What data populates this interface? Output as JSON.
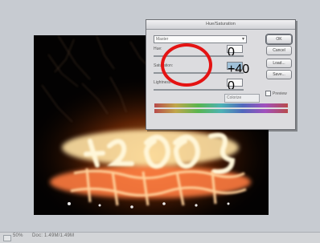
{
  "dialog": {
    "title": "Hue/Saturation",
    "edit_value": "Master",
    "rows": [
      {
        "label": "Hue:",
        "value": "0",
        "highlight": false
      },
      {
        "label": "Saturation:",
        "value": "+40",
        "highlight": true
      },
      {
        "label": "Lightness:",
        "value": "0",
        "highlight": false
      }
    ],
    "buttons": [
      "OK",
      "Cancel",
      "Load...",
      "Save..."
    ],
    "colorize_label": "Colorize",
    "preview_label": "Preview"
  },
  "status": {
    "zoom": "50%",
    "info": "Doc: 1.49M/1.49M"
  },
  "colors": {
    "annotation_circle": "#e41313",
    "workspace": "#c7cbd1"
  },
  "icons": {
    "dropdown_arrow": "chevron-down-icon"
  }
}
